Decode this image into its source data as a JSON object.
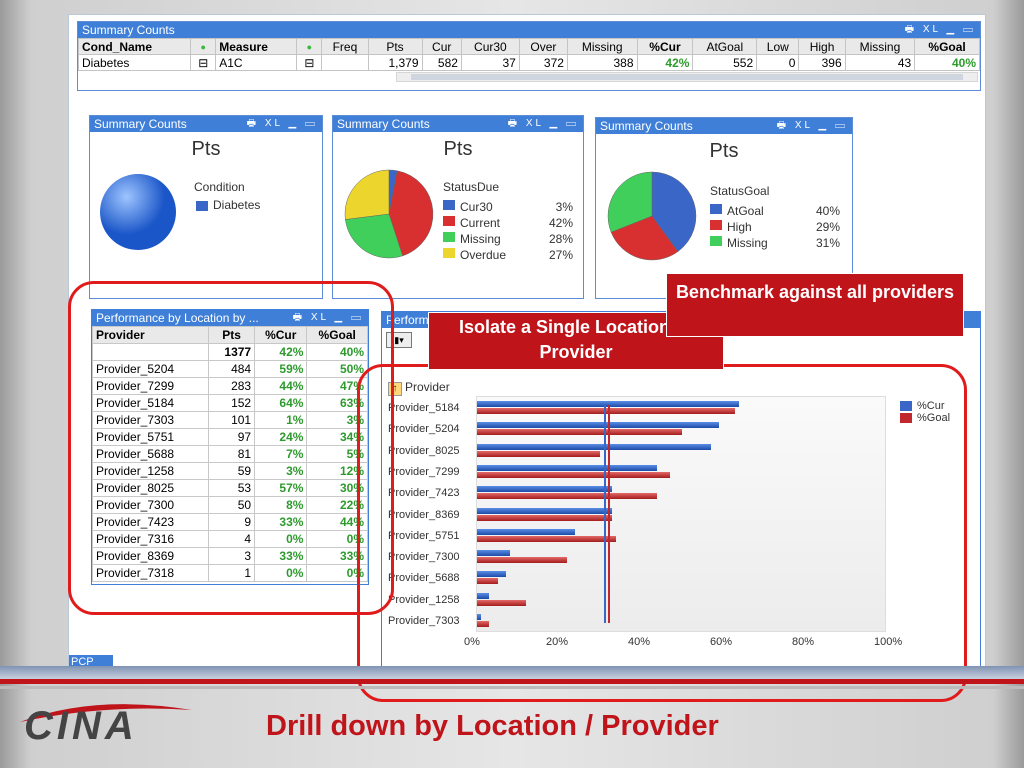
{
  "top_panel": {
    "title": "Summary Counts",
    "controls": "🖶 XL ▁ ▭",
    "headers": [
      "Cond_Name",
      "Measure",
      "Freq",
      "Pts",
      "Cur",
      "Cur30",
      "Over",
      "Missing",
      "%Cur",
      "AtGoal",
      "Low",
      "High",
      "Missing",
      "%Goal"
    ],
    "row": [
      "Diabetes",
      "A1C",
      "",
      "1,379",
      "582",
      "37",
      "372",
      "388",
      "42%",
      "552",
      "0",
      "396",
      "43",
      "40%"
    ]
  },
  "panel1": {
    "title": "Summary Counts",
    "big": "Pts",
    "legend_title": "Condition",
    "legend": [
      {
        "label": "Diabetes",
        "value": ""
      }
    ]
  },
  "panel2": {
    "title": "Summary Counts",
    "big": "Pts",
    "legend_title": "StatusDue",
    "legend": [
      {
        "label": "Cur30",
        "value": "3%"
      },
      {
        "label": "Current",
        "value": "42%"
      },
      {
        "label": "Missing",
        "value": "28%"
      },
      {
        "label": "Overdue",
        "value": "27%"
      }
    ]
  },
  "panel3": {
    "title": "Summary Counts",
    "big": "Pts",
    "legend_title": "StatusGoal",
    "legend": [
      {
        "label": "AtGoal",
        "value": "40%"
      },
      {
        "label": "High",
        "value": "29%"
      },
      {
        "label": "Missing",
        "value": "31%"
      }
    ]
  },
  "perf": {
    "title": "Performance by Location by ...",
    "headers": [
      "Provider",
      "Pts",
      "%Cur",
      "%Goal"
    ],
    "total": [
      "",
      "1377",
      "42%",
      "40%"
    ],
    "rows": [
      [
        "Provider_5204",
        "484",
        "59%",
        "50%"
      ],
      [
        "Provider_7299",
        "283",
        "44%",
        "47%"
      ],
      [
        "Provider_5184",
        "152",
        "64%",
        "63%"
      ],
      [
        "Provider_7303",
        "101",
        "1%",
        "3%"
      ],
      [
        "Provider_5751",
        "97",
        "24%",
        "34%"
      ],
      [
        "Provider_5688",
        "81",
        "7%",
        "5%"
      ],
      [
        "Provider_1258",
        "59",
        "3%",
        "12%"
      ],
      [
        "Provider_8025",
        "53",
        "57%",
        "30%"
      ],
      [
        "Provider_7300",
        "50",
        "8%",
        "22%"
      ],
      [
        "Provider_7423",
        "9",
        "33%",
        "44%"
      ],
      [
        "Provider_7316",
        "4",
        "0%",
        "0%"
      ],
      [
        "Provider_8369",
        "3",
        "33%",
        "33%"
      ],
      [
        "Provider_7318",
        "1",
        "0%",
        "0%"
      ]
    ]
  },
  "chart_header": "Provider",
  "chart_title_partial": "Perform",
  "tab_label": "PCP",
  "callouts": {
    "isolate": "Isolate a Single Location or Provider",
    "benchmark": "Benchmark against all providers"
  },
  "footer": {
    "logo": "CINA",
    "caption": "Drill down by Location / Provider"
  },
  "colors": {
    "blue": "#3a66c8",
    "red": "#c0282e",
    "title_bar": "#3f7fd8",
    "accent": "#c0141b"
  },
  "chart_data": {
    "type": "bar",
    "orientation": "horizontal",
    "categories": [
      "Provider_5184",
      "Provider_5204",
      "Provider_8025",
      "Provider_7299",
      "Provider_7423",
      "Provider_8369",
      "Provider_5751",
      "Provider_7300",
      "Provider_5688",
      "Provider_1258",
      "Provider_7303"
    ],
    "series": [
      {
        "name": "%Cur",
        "color": "#3a66c8",
        "values": [
          64,
          59,
          57,
          44,
          33,
          33,
          24,
          8,
          7,
          3,
          1
        ]
      },
      {
        "name": "%Goal",
        "color": "#c0282e",
        "values": [
          63,
          50,
          30,
          47,
          44,
          33,
          34,
          22,
          5,
          12,
          3
        ]
      }
    ],
    "reference_lines": [
      {
        "series": "%Cur",
        "value": 31
      },
      {
        "series": "%Goal",
        "value": 32
      }
    ],
    "xticks": [
      "0%",
      "20%",
      "40%",
      "60%",
      "80%",
      "100%"
    ],
    "xlim": [
      0,
      100
    ],
    "legend_position": "top-right"
  }
}
